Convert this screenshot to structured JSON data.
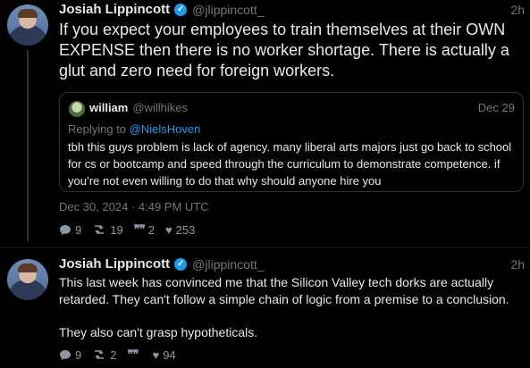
{
  "tweet1": {
    "author_name": "Josiah Lippincott",
    "handle": "@jlippincott_",
    "time": "2h",
    "text": "If you expect your employees to train themselves at their OWN EXPENSE then there is no worker shortage. There is actually a glut and zero need for foreign workers.",
    "quote": {
      "author_name": "william",
      "handle": "@willhikes",
      "date": "Dec 29",
      "replying_to_prefix": "Replying to",
      "replying_to_handle": "@NielsHoven",
      "text": "tbh this guys problem is lack of agency. many liberal arts majors just go back to school for cs or bootcamp and speed through the curriculum to demonstrate competence. if you’re not even willing to do that why should anyone hire you"
    },
    "timestamp": "Dec 30, 2024 · 4:49 PM UTC",
    "stats": {
      "replies": "9",
      "retweets": "19",
      "quotes": "2",
      "likes": "253"
    }
  },
  "tweet2": {
    "author_name": "Josiah Lippincott",
    "handle": "@jlippincott_",
    "time": "2h",
    "text_line1": "This last week has convinced me that the Silicon Valley tech dorks are actually retarded. They can't follow a simple chain of logic from a premise to a conclusion.",
    "text_line2": "They also can't grasp hypotheticals.",
    "stats": {
      "replies": "9",
      "retweets": "2",
      "quotes": "",
      "likes": "94"
    }
  },
  "colors": {
    "background": "#000000",
    "text": "#e7e9ea",
    "muted": "#71767b",
    "accent": "#1d9bf0"
  },
  "icons": [
    "verified-badge-icon",
    "reply-icon",
    "retweet-icon",
    "quote-icon",
    "heart-icon"
  ]
}
